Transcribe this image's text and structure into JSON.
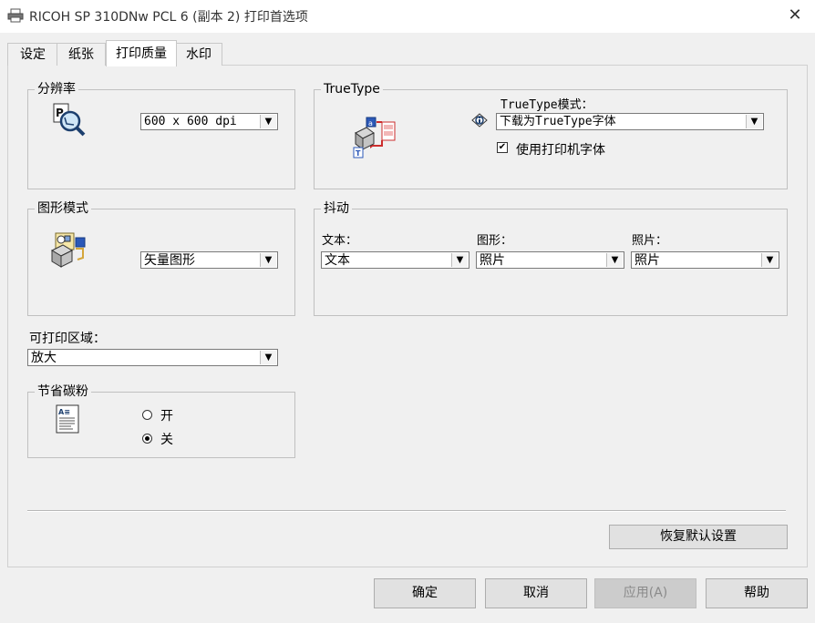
{
  "window": {
    "title": "RICOH SP 310DNw PCL 6 (副本 2) 打印首选项",
    "close": "✕"
  },
  "tabs": [
    {
      "label": "设定"
    },
    {
      "label": "纸张"
    },
    {
      "label": "打印质量"
    },
    {
      "label": "水印"
    }
  ],
  "resolution": {
    "legend": "分辨率",
    "value": "600 x 600 dpi"
  },
  "truetype": {
    "legend": "TrueType",
    "mode_label": "TrueType模式：",
    "mode_value": "下载为TrueType字体",
    "use_printer_fonts": "使用打印机字体",
    "use_printer_fonts_checked": true
  },
  "graphics": {
    "legend": "图形模式",
    "value": "矢量图形"
  },
  "dither": {
    "legend": "抖动",
    "text_label": "文本：",
    "text_value": "文本",
    "graphic_label": "图形：",
    "graphic_value": "照片",
    "photo_label": "照片：",
    "photo_value": "照片"
  },
  "printable_area": {
    "label": "可打印区域：",
    "value": "放大"
  },
  "toner": {
    "legend": "节省碳粉",
    "on": "开",
    "off": "关",
    "selected": "off"
  },
  "restore_defaults": "恢复默认设置",
  "footer": {
    "ok": "确定",
    "cancel": "取消",
    "apply": "应用(A)",
    "help": "帮助"
  }
}
